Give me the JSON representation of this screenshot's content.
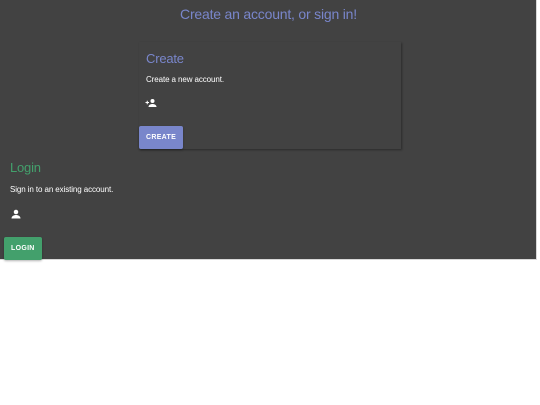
{
  "header": {
    "title": "Create an account, or sign in!"
  },
  "create": {
    "title": "Create",
    "description": "Create a new account.",
    "icon": "add-user-icon",
    "button_label": "CREATE",
    "accent_color": "#7986cb"
  },
  "login": {
    "title": "Login",
    "description": "Sign in to an existing account.",
    "icon": "person-icon",
    "button_label": "LOGIN",
    "accent_color": "#43a06c"
  }
}
